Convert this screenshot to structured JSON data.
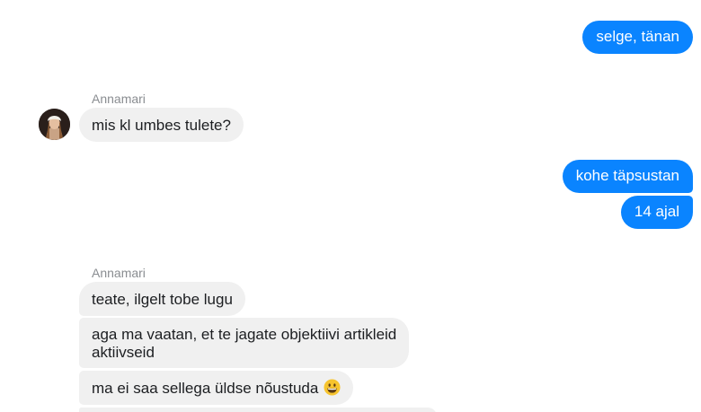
{
  "messages": {
    "out1": "selge, tänan",
    "group1": {
      "sender": "Annamari",
      "msg1": "mis kl umbes tulete?"
    },
    "out2": "kohe täpsustan",
    "out3": "14 ajal",
    "group2": {
      "sender": "Annamari",
      "msg1": "teate, ilgelt tobe lugu",
      "msg2_line1": "aga ma vaatan, et te jagate objektiivi artikleid",
      "msg2_line2": "aktiivseid",
      "msg3": "ma ei saa sellega üldse nõustuda"
    }
  },
  "colors": {
    "outgoing": "#0a84ff",
    "incoming": "#f0f0f0"
  },
  "icons": {
    "emoji": "grinning-face-emoji"
  }
}
